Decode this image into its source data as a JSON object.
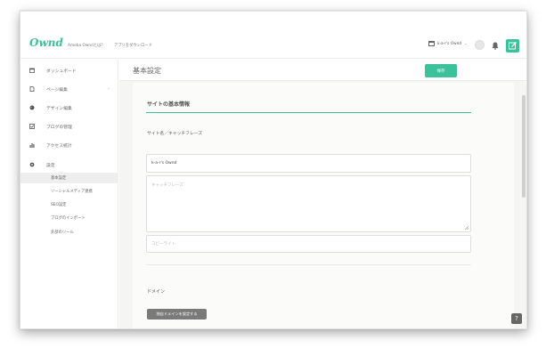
{
  "header": {
    "logo": "Ownd",
    "nav": [
      "Ameba Owndとは？",
      "アプリをダウンロード"
    ],
    "blog_selector": "k-a-r's Ownd"
  },
  "sidebar": {
    "items": [
      {
        "label": "ダッシュボード",
        "icon": "calendar-icon"
      },
      {
        "label": "ページ編集",
        "icon": "page-icon"
      },
      {
        "label": "デザイン編集",
        "icon": "palette-icon"
      },
      {
        "label": "ブログの管理",
        "icon": "check-icon"
      },
      {
        "label": "アクセス統計",
        "icon": "bar-chart-icon"
      },
      {
        "label": "設定",
        "icon": "gear-icon"
      }
    ],
    "sub_items": [
      "基本設定",
      "ソーシャルメディア連携",
      "SEO設定",
      "ブログのインポート",
      "外部のツール"
    ]
  },
  "main": {
    "page_title": "基本設定",
    "save_label": "保存",
    "section_heading": "サイトの基本情報",
    "field_label": "サイト名／キャッチフレーズ",
    "site_name_value": "k-a-r's Ownd",
    "catchphrase_placeholder": "キャッチフレーズ",
    "copyright_placeholder": "コピーライト",
    "domain_label": "ドメイン",
    "domain_button": "独自ドメインを設定する"
  },
  "help_label": "?",
  "colors": {
    "accent": "#3cc29a",
    "gray_button": "#7a7a7a"
  }
}
